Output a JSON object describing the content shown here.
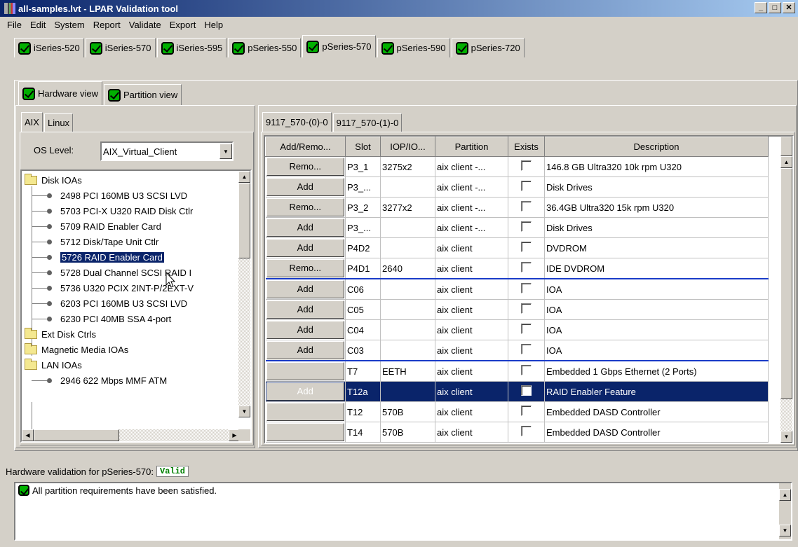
{
  "window": {
    "title": "all-samples.lvt - LPAR Validation tool"
  },
  "menu": [
    "File",
    "Edit",
    "System",
    "Report",
    "Validate",
    "Export",
    "Help"
  ],
  "system_tabs": [
    "iSeries-520",
    "iSeries-570",
    "iSeries-595",
    "pSeries-550",
    "pSeries-570",
    "pSeries-590",
    "pSeries-720"
  ],
  "view_tabs": [
    "Hardware view",
    "Partition view"
  ],
  "os_tabs": [
    "AIX",
    "Linux"
  ],
  "os_level": {
    "label": "OS Level:",
    "value": "AIX_Virtual_Client"
  },
  "tree": [
    {
      "type": "folder",
      "label": "Disk IOAs"
    },
    {
      "type": "leaf",
      "label": "2498 PCI 160MB U3 SCSI LVD"
    },
    {
      "type": "leaf",
      "label": "5703 PCI-X U320 RAID Disk Ctlr"
    },
    {
      "type": "leaf",
      "label": "5709 RAID Enabler Card"
    },
    {
      "type": "leaf",
      "label": "5712 Disk/Tape Unit Ctlr"
    },
    {
      "type": "leaf",
      "label": "5726 RAID Enabler Card"
    },
    {
      "type": "leaf",
      "label": "5728 Dual Channel SCSI RAID I"
    },
    {
      "type": "leaf",
      "label": "5736 U320 PCIX 2INT-P/2EXT-V"
    },
    {
      "type": "leaf",
      "label": "6203 PCI 160MB U3 SCSI LVD"
    },
    {
      "type": "leaf",
      "label": "6230 PCI 40MB SSA 4-port"
    },
    {
      "type": "folder",
      "label": "Ext Disk Ctrls"
    },
    {
      "type": "folder",
      "label": "Magnetic Media IOAs"
    },
    {
      "type": "folder",
      "label": "LAN IOAs"
    },
    {
      "type": "leaf",
      "label": "2946 622 Mbps MMF ATM"
    }
  ],
  "frame_tabs": [
    "9117_570-(0)-0",
    "9117_570-(1)-0"
  ],
  "table": {
    "headers": [
      "Add/Remo...",
      "Slot",
      "IOP/IO...",
      "Partition",
      "Exists",
      "Description"
    ],
    "rows": [
      {
        "btn": "Remo...",
        "slot": "P3_1",
        "iop": "3275x2",
        "partition": "aix client -...",
        "desc": "146.8 GB Ultra320 10k rpm U320"
      },
      {
        "btn": "Add",
        "slot": "P3_...",
        "iop": "",
        "partition": "aix client -...",
        "desc": "Disk Drives"
      },
      {
        "btn": "Remo...",
        "slot": "P3_2",
        "iop": "3277x2",
        "partition": "aix client -...",
        "desc": "36.4GB Ultra320 15k rpm U320"
      },
      {
        "btn": "Add",
        "slot": "P3_...",
        "iop": "",
        "partition": "aix client -...",
        "desc": "Disk Drives"
      },
      {
        "btn": "Add",
        "slot": "P4D2",
        "iop": "",
        "partition": "aix client",
        "desc": "DVDROM"
      },
      {
        "btn": "Remo...",
        "slot": "P4D1",
        "iop": "2640",
        "partition": "aix client",
        "desc": "IDE DVDROM"
      },
      {
        "btn": "Add",
        "slot": "C06",
        "iop": "",
        "partition": "aix client",
        "desc": "IOA"
      },
      {
        "btn": "Add",
        "slot": "C05",
        "iop": "",
        "partition": "aix client",
        "desc": "IOA"
      },
      {
        "btn": "Add",
        "slot": "C04",
        "iop": "",
        "partition": "aix client",
        "desc": "IOA"
      },
      {
        "btn": "Add",
        "slot": "C03",
        "iop": "",
        "partition": "aix client",
        "desc": "IOA"
      },
      {
        "btn": "",
        "slot": "T7",
        "iop": "EETH",
        "partition": "aix client",
        "desc": "Embedded 1 Gbps Ethernet (2 Ports)"
      },
      {
        "btn": "Add",
        "slot": "T12a",
        "iop": "",
        "partition": "aix client",
        "desc": "RAID Enabler Feature"
      },
      {
        "btn": "",
        "slot": "T12",
        "iop": "570B",
        "partition": "aix client",
        "desc": "Embedded DASD Controller"
      },
      {
        "btn": "",
        "slot": "T14",
        "iop": "570B",
        "partition": "aix client",
        "desc": "Embedded DASD Controller"
      }
    ]
  },
  "validation": {
    "label": "Hardware validation for pSeries-570:",
    "status": "Valid",
    "message": "All partition requirements have been satisfied."
  }
}
